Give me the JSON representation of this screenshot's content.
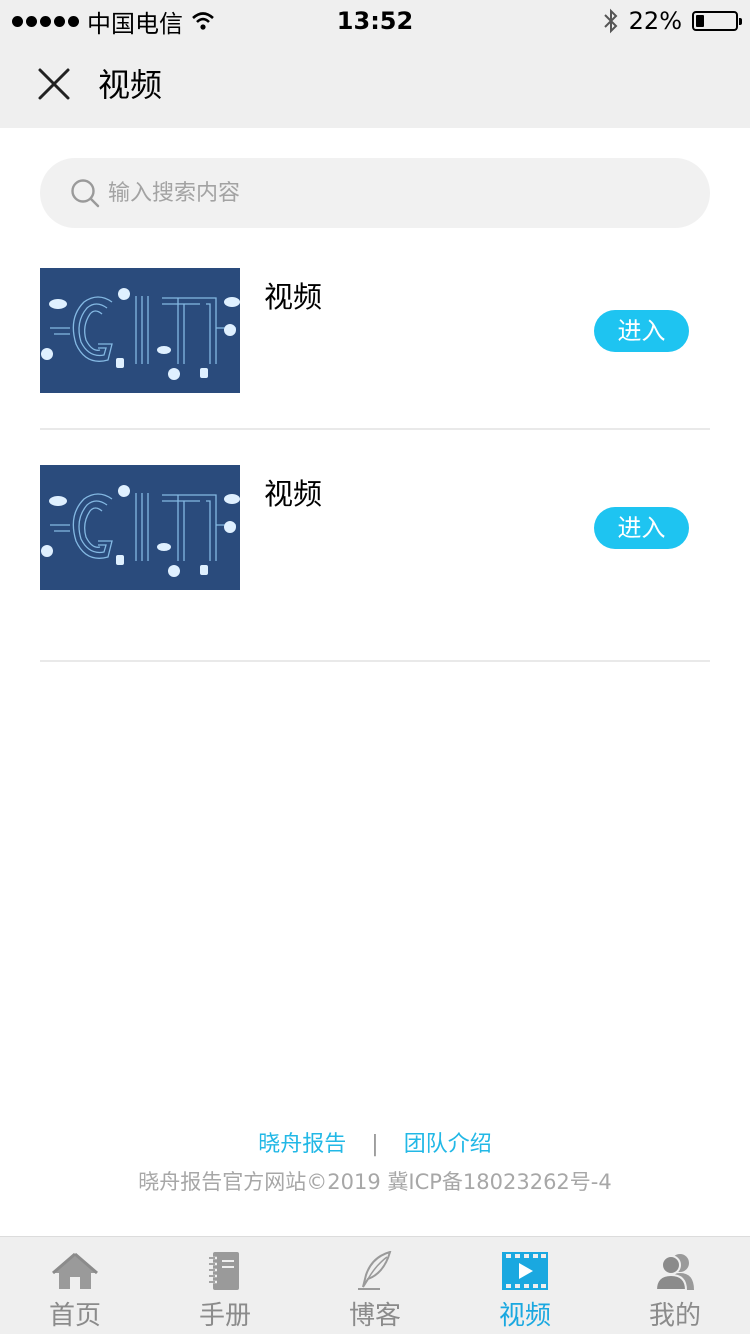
{
  "status_bar": {
    "carrier": "中国电信",
    "time": "13:52",
    "battery_text": "22%",
    "battery_level": 0.22
  },
  "nav": {
    "title": "视频",
    "close_icon": "close-icon"
  },
  "search": {
    "placeholder": "输入搜索内容",
    "icon": "search-icon"
  },
  "items": [
    {
      "title": "视频",
      "button_label": "进入",
      "thumb_text": "GIT"
    },
    {
      "title": "视频",
      "button_label": "进入",
      "thumb_text": "GIT"
    }
  ],
  "footer": {
    "link1": "晓舟报告",
    "separator": "|",
    "link2": "团队介绍",
    "copyright": "晓舟报告官方网站©2019 冀ICP备18023262号-4"
  },
  "tabs": [
    {
      "label": "首页",
      "icon": "home-icon",
      "active": false
    },
    {
      "label": "手册",
      "icon": "notebook-icon",
      "active": false
    },
    {
      "label": "博客",
      "icon": "quill-icon",
      "active": false
    },
    {
      "label": "视频",
      "icon": "video-icon",
      "active": true
    },
    {
      "label": "我的",
      "icon": "user-icon",
      "active": false
    }
  ],
  "colors": {
    "accent": "#1ec4f1",
    "tab_active": "#1aa8e0",
    "thumb_bg": "#2a4b7c"
  }
}
